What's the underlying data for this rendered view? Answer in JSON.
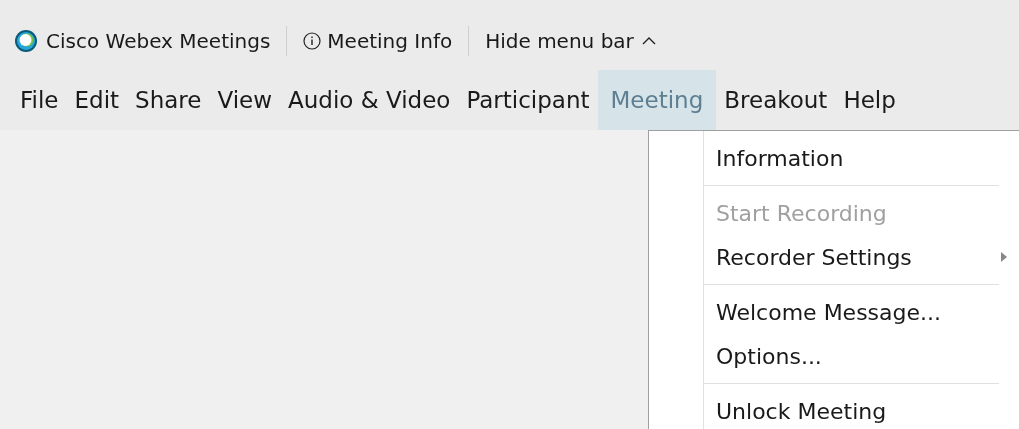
{
  "title_bar": {
    "app_name": "Cisco Webex Meetings",
    "meeting_info": "Meeting Info",
    "hide_menu": "Hide menu bar"
  },
  "menu_bar": [
    {
      "label": "File",
      "selected": false
    },
    {
      "label": "Edit",
      "selected": false
    },
    {
      "label": "Share",
      "selected": false
    },
    {
      "label": "View",
      "selected": false
    },
    {
      "label": "Audio & Video",
      "selected": false
    },
    {
      "label": "Participant",
      "selected": false
    },
    {
      "label": "Meeting",
      "selected": true
    },
    {
      "label": "Breakout",
      "selected": false
    },
    {
      "label": "Help",
      "selected": false
    }
  ],
  "dropdown": {
    "groups": [
      [
        {
          "label": "Information",
          "disabled": false,
          "submenu": false
        }
      ],
      [
        {
          "label": "Start Recording",
          "disabled": true,
          "submenu": false
        },
        {
          "label": "Recorder Settings",
          "disabled": false,
          "submenu": true
        }
      ],
      [
        {
          "label": "Welcome Message...",
          "disabled": false,
          "submenu": false
        },
        {
          "label": "Options...",
          "disabled": false,
          "submenu": false
        }
      ],
      [
        {
          "label": "Unlock Meeting",
          "disabled": false,
          "submenu": false
        }
      ]
    ]
  }
}
